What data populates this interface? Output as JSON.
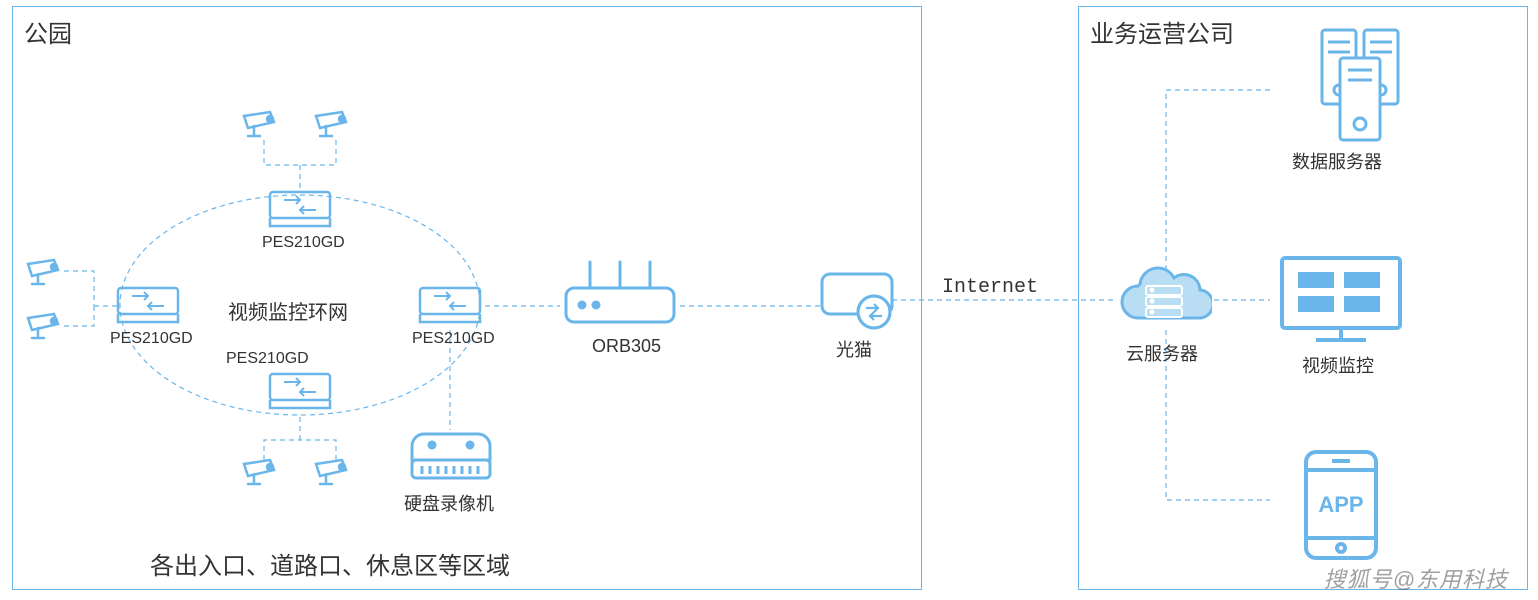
{
  "left_box_title": "公园",
  "right_box_title": "业务运营公司",
  "ring_label": "视频监控环网",
  "pes_label": "PES210GD",
  "orb_label": "ORB305",
  "modem_label": "光猫",
  "nvr_label": "硬盘录像机",
  "bottom_caption": "各出入口、道路口、休息区等区域",
  "internet_label": "Internet",
  "cloud_label": "云服务器",
  "data_server_label": "数据服务器",
  "video_monitor_label": "视频监控",
  "app_label": "APP",
  "watermark": "搜狐号@东用科技",
  "colors": {
    "line": "#6ab6eb",
    "icon": "#6ab6eb",
    "text": "#333"
  }
}
